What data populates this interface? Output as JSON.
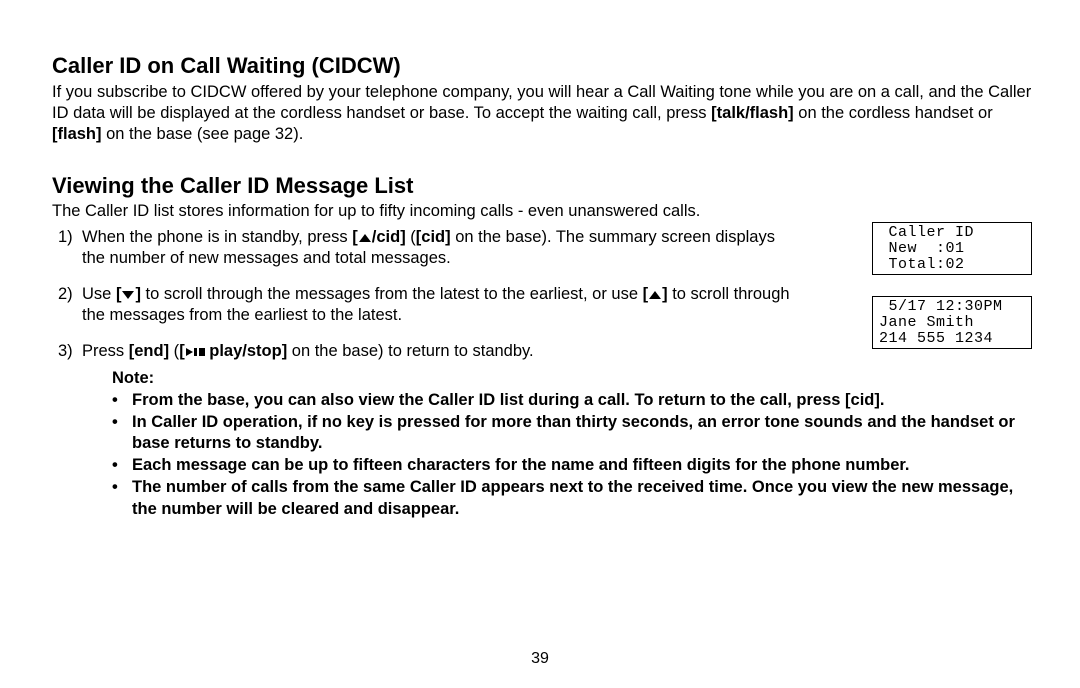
{
  "sec1": {
    "heading": "Caller ID on Call Waiting (CIDCW)",
    "para_a": "If you subscribe to CIDCW offered by your telephone company, you will hear a Call Waiting tone while you are on a call, and the Caller ID data will be displayed at the cordless handset or base. To accept the waiting call, press ",
    "talkflash": "[talk/flash]",
    "para_b": " on the cordless handset or ",
    "flash": "[flash]",
    "para_c": " on the base (see page 32)."
  },
  "sec2": {
    "heading": "Viewing the Caller ID Message List",
    "intro": "The Caller ID list stores information for up to fifty incoming calls - even unanswered calls.",
    "li1_a": "When the phone is in standby, press ",
    "li1_cid_h": "/cid]",
    "li1_b": " (",
    "li1_cid_b": "[cid]",
    "li1_c": " on the base). The summary screen displays the number of new messages and total messages.",
    "li2_a": "Use ",
    "li2_b": " to scroll through the messages from the latest to the earliest, or use ",
    "li2_c": " to scroll through the messages from the earliest to the latest.",
    "li3_a": "Press ",
    "li3_end": "[end]",
    "li3_b": " (",
    "li3_ps_b": " play/stop]",
    "li3_c": " on the base) to return to standby.",
    "note_label": "Note:",
    "notes": [
      "From the base, you can also view the Caller ID list during a call. To return to the call, press [cid].",
      "In Caller ID operation, if no key is pressed for more than thirty seconds, an error tone sounds and the handset or base returns to standby.",
      "Each message can be up to fifteen characters for the name and fifteen digits for the phone number.",
      "The number of calls from the same Caller ID appears next to the received time. Once you view the new message, the number will be cleared and disappear."
    ]
  },
  "lcd1": " Caller ID\n New  :01\n Total:02",
  "lcd2": " 5/17 12:30PM\nJane Smith\n214 555 1234",
  "page_number": "39",
  "nums": {
    "n1": "1)",
    "n2": "2)",
    "n3": "3)"
  },
  "brackets": {
    "open": "[",
    "close": "]"
  }
}
